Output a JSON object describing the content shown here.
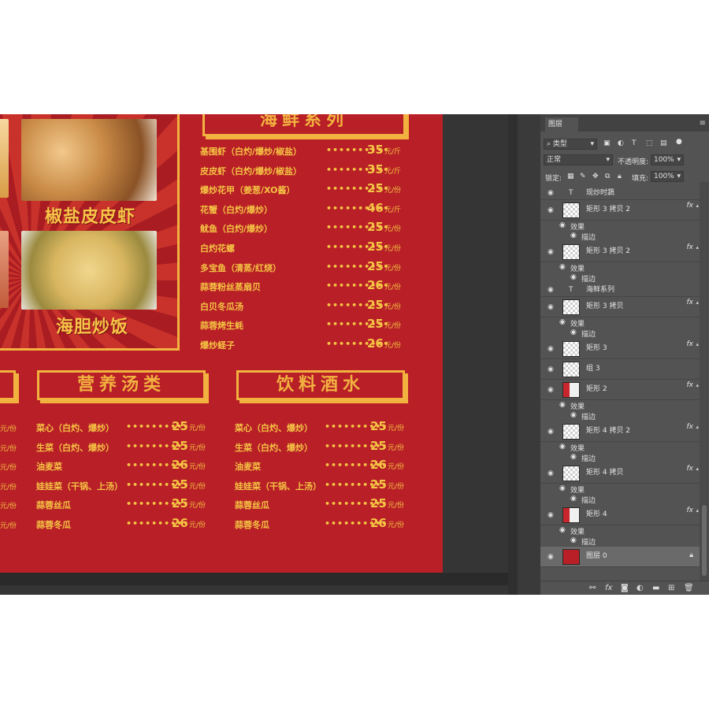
{
  "poster": {
    "seafood_title": "海鲜系列",
    "dish1_caption": "椒盐皮皮虾",
    "dish2_caption": "海胆炒饭",
    "soup_title": "营养汤类",
    "drink_title": "饮料酒水",
    "seafood_items": [
      {
        "name": "基围虾（白灼/爆炒/椒盐）",
        "price": "35",
        "unit": "元/斤"
      },
      {
        "name": "皮皮虾（白灼/爆炒/椒盐）",
        "price": "35",
        "unit": "元/斤"
      },
      {
        "name": "爆炒花甲（姜葱/XO酱）",
        "price": "25",
        "unit": "元/份"
      },
      {
        "name": "花蟹（白灼/爆炒）",
        "price": "46",
        "unit": "元/斤"
      },
      {
        "name": "鱿鱼（白灼/爆炒）",
        "price": "25",
        "unit": "元/份"
      },
      {
        "name": "白灼花螺",
        "price": "25",
        "unit": "元/份"
      },
      {
        "name": "多宝鱼（清蒸/红烧）",
        "price": "25",
        "unit": "元/份"
      },
      {
        "name": "蒜蓉粉丝蒸扇贝",
        "price": "26",
        "unit": "元/份"
      },
      {
        "name": "白贝冬瓜汤",
        "price": "25",
        "unit": "元/份"
      },
      {
        "name": "蒜蓉烤生蚝",
        "price": "25",
        "unit": "元/份"
      },
      {
        "name": "爆炒蛏子",
        "price": "26",
        "unit": "元/份"
      }
    ],
    "left_units": [
      "元/份",
      "元/份",
      "元/份",
      "元/份",
      "元/份",
      "元/份"
    ],
    "soup_items": [
      {
        "name": "菜心（白灼、爆炒）",
        "price": "25",
        "unit": "元/份"
      },
      {
        "name": "生菜（白灼、爆炒）",
        "price": "25",
        "unit": "元/份"
      },
      {
        "name": "油麦菜",
        "price": "26",
        "unit": "元/份"
      },
      {
        "name": "娃娃菜（干锅、上汤）",
        "price": "25",
        "unit": "元/份"
      },
      {
        "name": "蒜蓉丝瓜",
        "price": "25",
        "unit": "元/份"
      },
      {
        "name": "蒜蓉冬瓜",
        "price": "26",
        "unit": "元/份"
      }
    ],
    "drink_items": [
      {
        "name": "菜心（白灼、爆炒）",
        "price": "25",
        "unit": "元/份"
      },
      {
        "name": "生菜（白灼、爆炒）",
        "price": "25",
        "unit": "元/份"
      },
      {
        "name": "油麦菜",
        "price": "26",
        "unit": "元/份"
      },
      {
        "name": "娃娃菜（干锅、上汤）",
        "price": "25",
        "unit": "元/份"
      },
      {
        "name": "蒜蓉丝瓜",
        "price": "25",
        "unit": "元/份"
      },
      {
        "name": "蒜蓉冬瓜",
        "price": "26",
        "unit": "元/份"
      }
    ],
    "dots": "••••••••••"
  },
  "layers_panel": {
    "tab_label": "图层",
    "filter_label": "类型",
    "blend_mode": "正常",
    "opacity_label": "不透明度:",
    "opacity_value": "100%",
    "lock_label": "锁定:",
    "fill_label": "填充:",
    "fill_value": "100%",
    "effect_label": "效果",
    "stroke_label": "描边",
    "layers": [
      {
        "name": "现炒时蔬",
        "kind": "text",
        "fx": false,
        "effects": false
      },
      {
        "name": "矩形 3 拷贝 2",
        "kind": "shape",
        "fx": true,
        "effects": true
      },
      {
        "name": "矩形 3 拷贝 2",
        "kind": "shape",
        "fx": true,
        "effects": true
      },
      {
        "name": "海鲜系列",
        "kind": "text",
        "fx": false,
        "effects": false
      },
      {
        "name": "矩形 3 拷贝",
        "kind": "shape",
        "fx": true,
        "effects": true
      },
      {
        "name": "矩形 3",
        "kind": "shape",
        "fx": true,
        "effects": false
      },
      {
        "name": "组 3",
        "kind": "group",
        "fx": false,
        "effects": false
      },
      {
        "name": "矩形 2",
        "kind": "shape-red",
        "fx": true,
        "effects": true
      },
      {
        "name": "矩形 4 拷贝 2",
        "kind": "shape",
        "fx": true,
        "effects": true
      },
      {
        "name": "矩形 4 拷贝",
        "kind": "shape",
        "fx": true,
        "effects": true
      },
      {
        "name": "矩形 4",
        "kind": "shape-red",
        "fx": true,
        "effects": true
      },
      {
        "name": "图层 0",
        "kind": "fill",
        "fx": false,
        "effects": false
      }
    ]
  },
  "colors": {
    "poster_red": "#b81f26",
    "gold": "#f2b240"
  }
}
